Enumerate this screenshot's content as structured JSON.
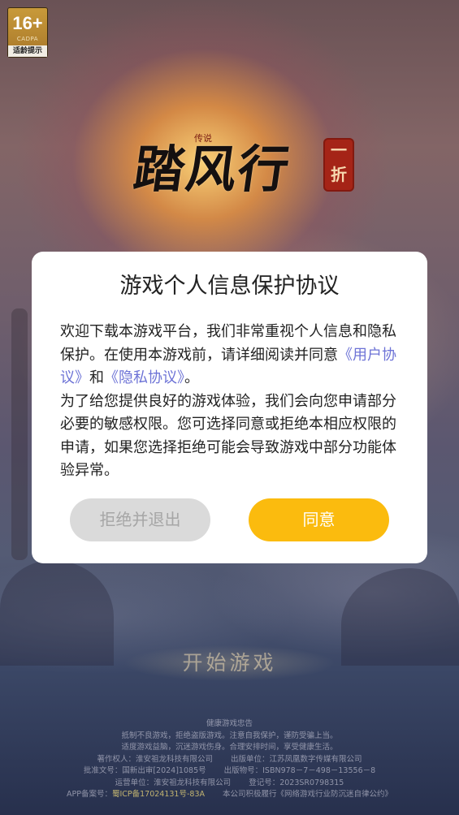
{
  "age_badge": {
    "rating": "16+",
    "org": "CADPA",
    "tip": "适龄提示"
  },
  "logo": {
    "title": "踏风行",
    "small": "传说",
    "seal": "一折"
  },
  "dialog": {
    "title": "游戏个人信息保护协议",
    "para1_text": "欢迎下载本游戏平台，我们非常重视个人信息和隐私保护。在使用本游戏前，请详细阅读并同意",
    "user_agreement_link": "《用户协议》",
    "and_text": "和",
    "privacy_link": "《隐私协议》",
    "period": "。",
    "para2_text": "为了给您提供良好的游戏体验，我们会向您申请部分必要的敏感权限。您可选择同意或拒绝本相应权限的申请，如果您选择拒绝可能会导致游戏中部分功能体验异常。",
    "decline_label": "拒绝并退出",
    "agree_label": "同意"
  },
  "start_game_label": "开始游戏",
  "footer": {
    "heading": "健康游戏忠告",
    "advice_1": "抵制不良游戏，拒绝盗版游戏。注意自我保护，谨防受骗上当。",
    "advice_2": "适度游戏益脑，沉迷游戏伤身。合理安排时间，享受健康生活。",
    "copyright_holder": "著作权人：淮安祖龙科技有限公司",
    "publisher": "出版单位：江苏凤凰数字传媒有限公司",
    "approval_no": "批准文号：国新出审[2024]1085号",
    "publication_no": "出版物号：ISBN978－7－498－13556－8",
    "operator": "运营单位：淮安祖龙科技有限公司",
    "registration_no": "登记号：2023SR0798315",
    "app_filing_label": "APP备案号：",
    "app_filing_no": "蜀ICP备17024131号-83A",
    "compliance": "本公司积极履行《网络游戏行业防沉迷自律公约》"
  },
  "colors": {
    "agree_button": "#fbbb0e",
    "decline_button": "#dadada",
    "link": "#6d73d6",
    "dialog_bg": "#ffffff"
  }
}
